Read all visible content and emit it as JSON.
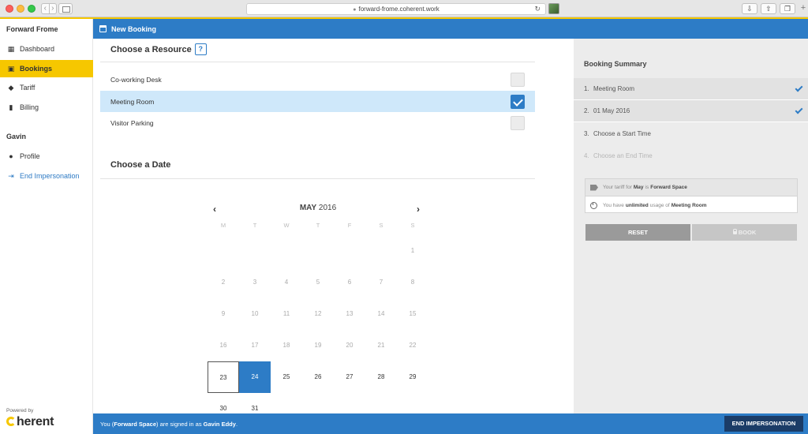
{
  "browser": {
    "url": "forward-frome.coherent.work"
  },
  "sidebar": {
    "org_name": "Forward Frome",
    "items": [
      {
        "label": "Dashboard",
        "icon": "dashboard-icon"
      },
      {
        "label": "Bookings",
        "icon": "calendar-icon"
      },
      {
        "label": "Tariff",
        "icon": "tag-icon"
      },
      {
        "label": "Billing",
        "icon": "document-icon"
      }
    ],
    "user_section": "Gavin",
    "user_items": [
      {
        "label": "Profile",
        "icon": "user-icon"
      },
      {
        "label": "End Impersonation",
        "icon": "sign-in-icon"
      }
    ],
    "powered_by": "Powered by",
    "brand": "herent"
  },
  "header": {
    "title": "New Booking"
  },
  "resource": {
    "title": "Choose a Resource",
    "help": "?",
    "options": [
      {
        "label": "Co-working Desk",
        "checked": false
      },
      {
        "label": "Meeting Room",
        "checked": true
      },
      {
        "label": "Visitor Parking",
        "checked": false
      }
    ]
  },
  "date": {
    "title": "Choose a Date",
    "month": "MAY",
    "year": "2016",
    "prev": "‹",
    "next": "›",
    "weekdays": [
      "M",
      "T",
      "W",
      "T",
      "F",
      "S",
      "S"
    ],
    "days": [
      "1",
      "2",
      "3",
      "4",
      "5",
      "6",
      "7",
      "8",
      "9",
      "10",
      "11",
      "12",
      "13",
      "14",
      "15",
      "16",
      "17",
      "18",
      "19",
      "20",
      "21",
      "22",
      "23",
      "24",
      "25",
      "26",
      "27",
      "28",
      "29",
      "30",
      "31"
    ]
  },
  "summary": {
    "title": "Booking Summary",
    "steps": [
      {
        "num": "1.",
        "label": "Meeting Room"
      },
      {
        "num": "2.",
        "label": "01 May 2016"
      },
      {
        "num": "3.",
        "label": "Choose a Start Time"
      },
      {
        "num": "4.",
        "label": "Choose an End Time"
      }
    ],
    "tariff_prefix": "Your tariff for",
    "tariff_month": "May",
    "tariff_mid": "is",
    "tariff_name": "Forward Space",
    "usage_prefix": "You have",
    "usage_amount": "unlimited",
    "usage_mid": "usage of",
    "usage_resource": "Meeting Room",
    "reset_label": "RESET",
    "book_label": "BOOK"
  },
  "footer": {
    "prefix": "You (",
    "org": "Forward Space",
    "mid": ") are signed in as",
    "user": "Gavin Eddy",
    "suffix": ".",
    "end_button": "END IMPERSONATION"
  },
  "colors": {
    "primary": "#2d7cc6",
    "accent": "#f6c700",
    "selected_row": "#cfe8fa",
    "dark_button": "#1b3c67"
  }
}
